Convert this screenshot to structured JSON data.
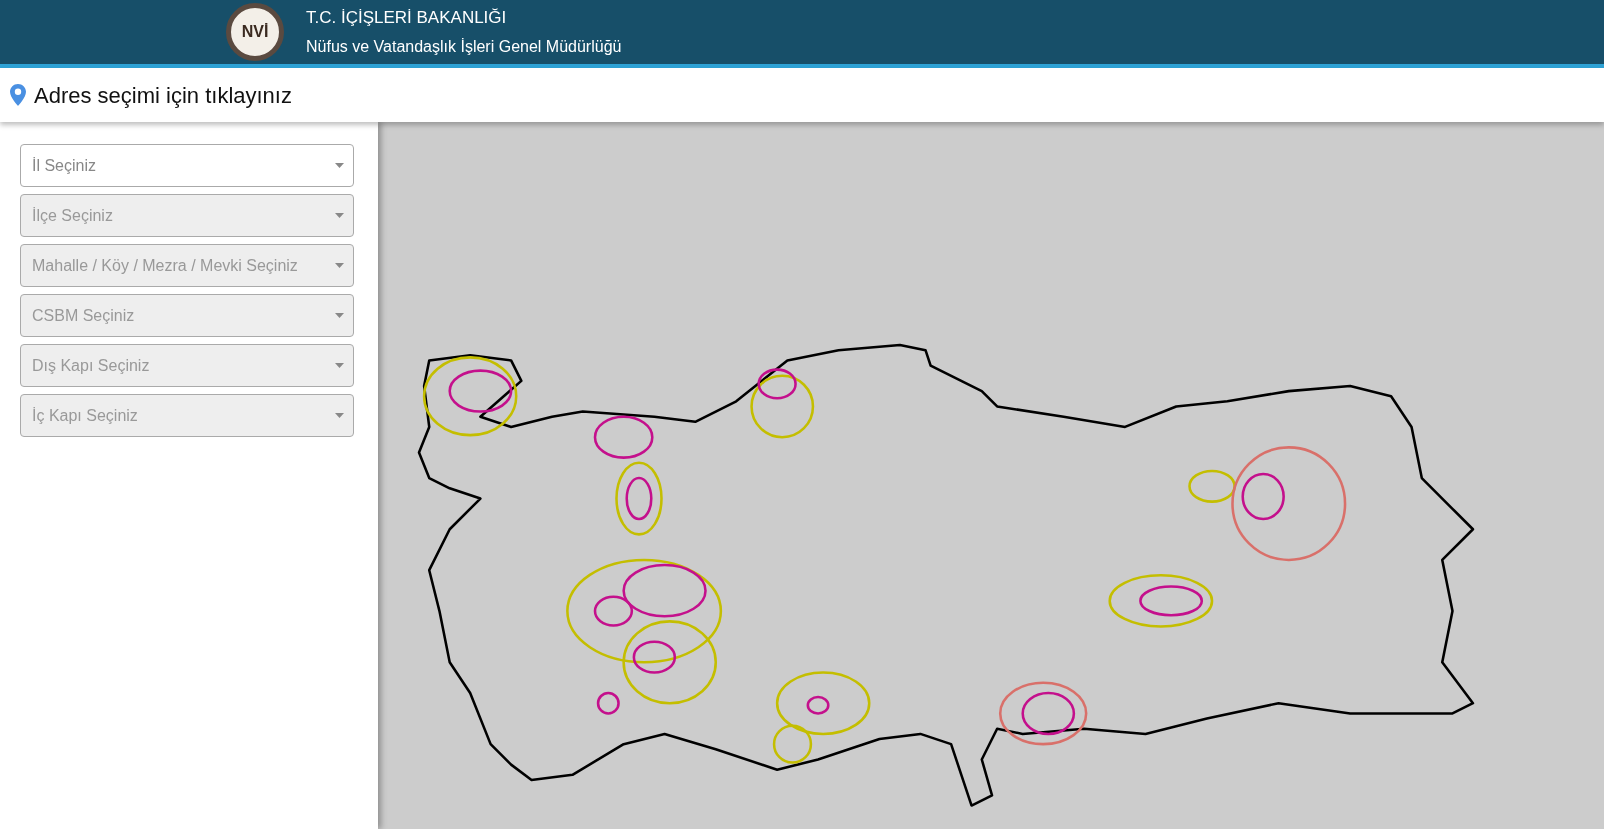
{
  "header": {
    "logo_text": "NVİ",
    "title": "T.C. İÇİŞLERİ BAKANLIĞI",
    "subtitle": "Nüfus ve Vatandaşlık İşleri Genel Müdürlüğü"
  },
  "address_bar": {
    "label": "Adres seçimi için tıklayınız"
  },
  "selects": [
    {
      "placeholder": "İl Seçiniz",
      "disabled": false
    },
    {
      "placeholder": "İlçe Seçiniz",
      "disabled": true
    },
    {
      "placeholder": "Mahalle / Köy / Mezra / Mevki Seçiniz",
      "disabled": true
    },
    {
      "placeholder": "CSBM Seçiniz",
      "disabled": true
    },
    {
      "placeholder": "Dış Kapı Seçiniz",
      "disabled": true
    },
    {
      "placeholder": "İç Kapı Seçiniz",
      "disabled": true
    }
  ]
}
